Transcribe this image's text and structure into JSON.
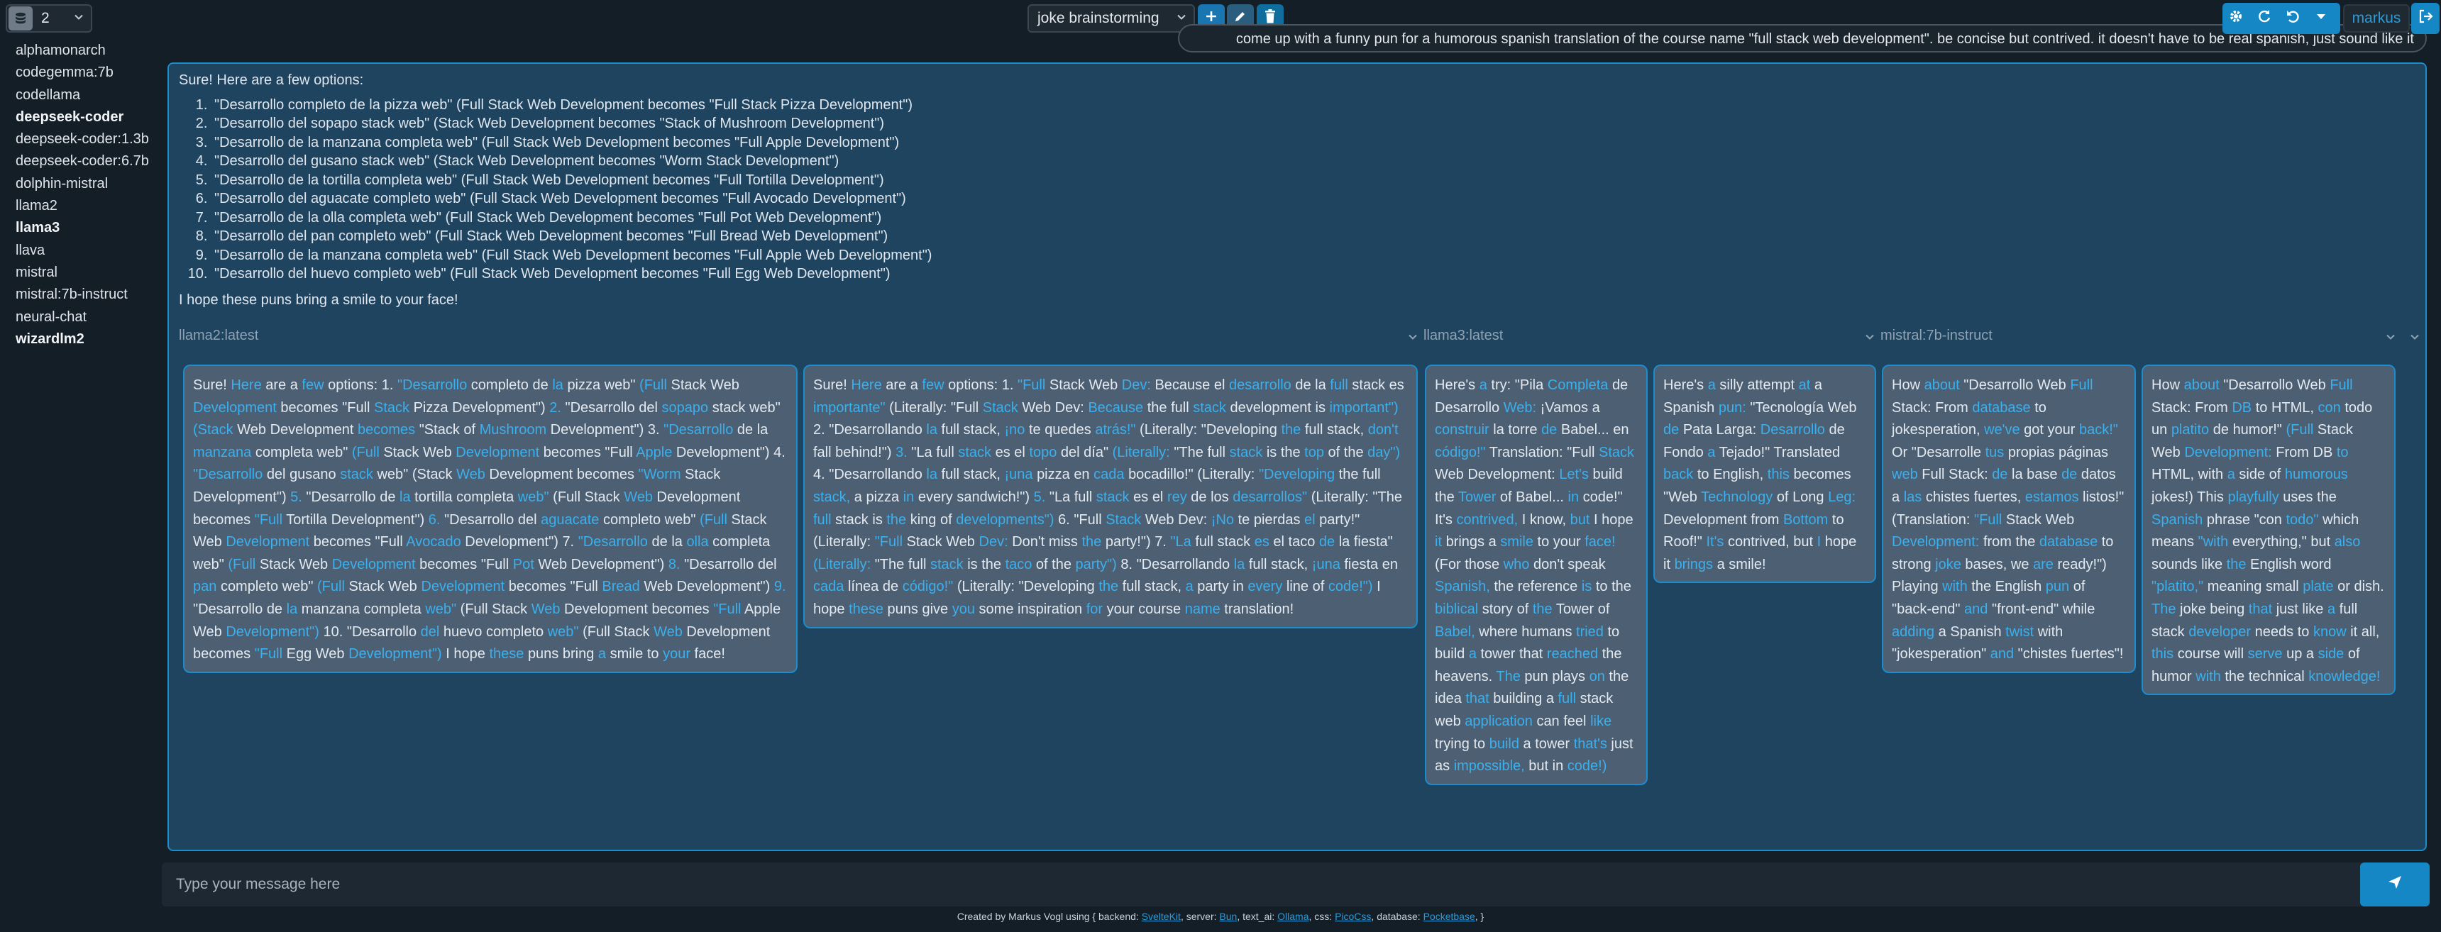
{
  "header": {
    "conversation_number": "2",
    "model_select_value": "joke brainstorming",
    "user_name": "markus",
    "prompt_text": "come up with a funny pun for a humorous spanish translation of the course name \"full stack web development\". be concise but contrived. it doesn't have to be real spanish, just sound like it"
  },
  "icons": {
    "db": "database-icon",
    "add": "plus-icon",
    "edit": "pencil-icon",
    "delete": "trash-icon",
    "settings": "gear-icon",
    "refresh": "refresh-icon",
    "undo": "undo-icon",
    "menu": "caret-down-icon",
    "logout": "logout-icon",
    "send": "send-icon"
  },
  "colors": {
    "accent": "#1587c4",
    "link": "#3ab0ee",
    "panel": "#1f4460",
    "bubble": "#4c5f73",
    "bg": "#141e26"
  },
  "sidebar": {
    "items": [
      {
        "label": "alphamonarch",
        "bold": false
      },
      {
        "label": "codegemma:7b",
        "bold": false
      },
      {
        "label": "codellama",
        "bold": false
      },
      {
        "label": "deepseek-coder",
        "bold": true
      },
      {
        "label": "deepseek-coder:1.3b",
        "bold": false
      },
      {
        "label": "deepseek-coder:6.7b",
        "bold": false
      },
      {
        "label": "dolphin-mistral",
        "bold": false
      },
      {
        "label": "llama2",
        "bold": false
      },
      {
        "label": "llama3",
        "bold": true
      },
      {
        "label": "llava",
        "bold": false
      },
      {
        "label": "mistral",
        "bold": false
      },
      {
        "label": "mistral:7b-instruct",
        "bold": false
      },
      {
        "label": "neural-chat",
        "bold": false
      },
      {
        "label": "wizardlm2",
        "bold": true
      }
    ]
  },
  "summary": {
    "intro": "Sure! Here are a few options:",
    "items": [
      "\"Desarrollo completo de la pizza web\" (Full Stack Web Development becomes \"Full Stack Pizza Development\")",
      "\"Desarrollo del sopapo stack web\" (Stack Web Development becomes \"Stack of Mushroom Development\")",
      "\"Desarrollo de la manzana completa web\" (Full Stack Web Development becomes \"Full Apple Development\")",
      "\"Desarrollo del gusano stack web\" (Stack Web Development becomes \"Worm Stack Development\")",
      "\"Desarrollo de la tortilla completa web\" (Full Stack Web Development becomes \"Full Tortilla Development\")",
      "\"Desarrollo del aguacate completo web\" (Full Stack Web Development becomes \"Full Avocado Development\")",
      "\"Desarrollo de la olla completa web\" (Full Stack Web Development becomes \"Full Pot Web Development\")",
      "\"Desarrollo del pan completo web\" (Full Stack Web Development becomes \"Full Bread Web Development\")",
      "\"Desarrollo de la manzana completa web\" (Full Stack Web Development becomes \"Full Apple Web Development\")",
      "\"Desarrollo del huevo completo web\" (Full Stack Web Development becomes \"Full Egg Web Development\")"
    ],
    "outro": "I hope these puns bring a smile to your face!"
  },
  "sections": [
    {
      "label": "llama2:latest"
    },
    {
      "label": "llama3:latest"
    },
    {
      "label": "mistral:7b-instruct"
    }
  ],
  "responses": [
    {
      "text": "Sure! Here are a few options: 1. \"Desarrollo completo de la pizza web\" (Full Stack Web Development becomes \"Full Stack Pizza Development\") 2. \"Desarrollo del sopapo stack web\" (Stack Web Development becomes \"Stack of Mushroom Development\") 3. \"Desarrollo de la manzana completa web\" (Full Stack Web Development becomes \"Full Apple Development\") 4. \"Desarrollo del gusano stack web\" (Stack Web Development becomes \"Worm Stack Development\") 5. \"Desarrollo de la tortilla completa web\" (Full Stack Web Development becomes \"Full Tortilla Development\") 6. \"Desarrollo del aguacate completo web\" (Full Stack Web Development becomes \"Full Avocado Development\") 7. \"Desarrollo de la olla completa web\" (Full Stack Web Development becomes \"Full Pot Web Development\") 8. \"Desarrollo del pan completo web\" (Full Stack Web Development becomes \"Full Bread Web Development\") 9. \"Desarrollo de la manzana completa web\" (Full Stack Web Development becomes \"Full Apple Web Development\") 10. \"Desarrollo del huevo completo web\" (Full Stack Web Development becomes \"Full Egg Web Development\") I hope these puns bring a smile to your face!"
    },
    {
      "text": "Sure! Here are a few options: 1. \"Full Stack Web Dev: Because el desarrollo de la full stack es importante\" (Literally: \"Full Stack Web Dev: Because the full stack development is important\") 2. \"Desarrollando la full stack, ¡no te quedes atrás!\" (Literally: \"Developing the full stack, don't fall behind!\") 3. \"La full stack es el topo del día\" (Literally: \"The full stack is the top of the day\") 4. \"Desarrollando la full stack, ¡una pizza en cada bocadillo!\" (Literally: \"Developing the full stack, a pizza in every sandwich!\") 5. \"La full stack es el rey de los desarrollos\" (Literally: \"The full stack is the king of developments\") 6. \"Full Stack Web Dev: ¡No te pierdas el party!\" (Literally: \"Full Stack Web Dev: Don't miss the party!\") 7. \"La full stack es el taco de la fiesta\" (Literally: \"The full stack is the taco of the party\") 8. \"Desarrollando la full stack, ¡una fiesta en cada línea de código!\" (Literally: \"Developing the full stack, a party in every line of code!\") I hope these puns give you some inspiration for your course name translation!"
    },
    {
      "text": "Here's a try: \"Pila Completa de Desarrollo Web: ¡Vamos a construir la torre de Babel... en código!\" Translation: \"Full Stack Web Development: Let's build the Tower of Babel... in code!\" It's contrived, I know, but I hope it brings a smile to your face! (For those who don't speak Spanish, the reference is to the biblical story of the Tower of Babel, where humans tried to build a tower that reached the heavens. The pun plays on the idea that building a full stack web application can feel like trying to build a tower that's just as impossible, but in code!)"
    },
    {
      "text": "Here's a silly attempt at a Spanish pun: \"Tecnología Web de Pata Larga: Desarrollo de Fondo a Tejado!\" Translated back to English, this becomes \"Web Technology of Long Leg: Development from Bottom to Roof!\" It's contrived, but I hope it brings a smile!"
    },
    {
      "text": "How about \"Desarrollo Web Full Stack: From database to jokesperation, we've got your back!\" Or \"Desarrolle tus propias páginas web Full Stack: de la base de datos a las chistes fuertes, estamos listos!\" (Translation: \"Full Stack Web Development: from the database to strong joke bases, we are ready!\") Playing with the English pun of \"back-end\" and \"front-end\" while adding a Spanish twist with \"jokesperation\" and \"chistes fuertes\"!"
    },
    {
      "text": "How about \"Desarrollo Web Full Stack: From DB to HTML, con todo un platito de humor!\" (Full Stack Web Development: From DB to HTML, with a side of humorous jokes!) This playfully uses the Spanish phrase \"con todo\" which means \"with everything,\" but also sounds like the English word \"platito,\" meaning small plate or dish. The joke being that just like a full stack developer needs to know it all, this course will serve up a side of humor with the technical knowledge!"
    }
  ],
  "input": {
    "placeholder": "Type your message here",
    "value": ""
  },
  "footer": {
    "prefix": "Created by Markus Vogl using { backend: ",
    "backend": "SvelteKit",
    "server_label": ", server: ",
    "server": "Bun",
    "ai_label": ", text_ai: ",
    "ai": "Ollama",
    "css_label": ", css: ",
    "css": "PicoCss",
    "db_label": ", database: ",
    "db": "Pocketbase",
    "suffix": ", }"
  }
}
